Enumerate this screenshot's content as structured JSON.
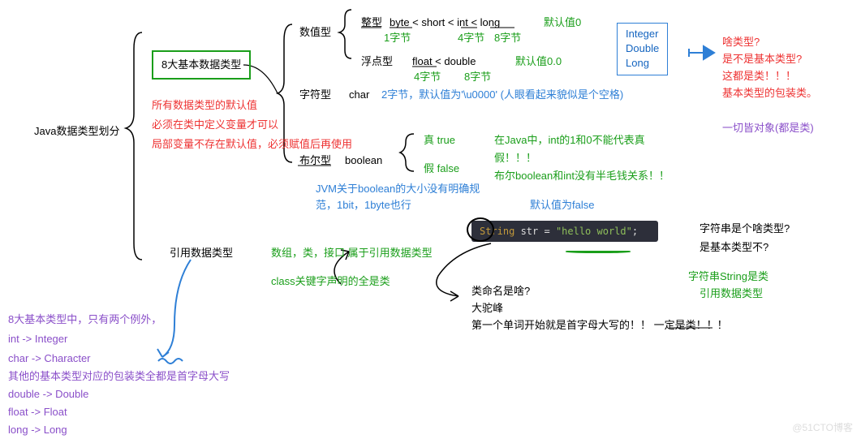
{
  "root": {
    "title": "Java数据类型划分"
  },
  "primitive": {
    "boxLabel": "8大基本数据类型",
    "defaultNote1": "所有数据类型的默认值",
    "defaultNote2": "必须在类中定义变量才可以",
    "defaultNote3": "局部变量不存在默认值，必须赋值后再使用",
    "numeric": {
      "label": "数值型",
      "integer": {
        "label": "整型",
        "order": "byte < short < int < long",
        "byteSize": "1字节",
        "intSize": "4字节",
        "longSize": "8字节",
        "default": "默认值0"
      },
      "float": {
        "label": "浮点型",
        "order": "float < double",
        "floatSize": "4字节",
        "doubleSize": "8字节",
        "default": "默认值0.0"
      }
    },
    "char": {
      "label": "字符型",
      "type": "char",
      "note": "2字节，默认值为'\\u0000' (人眼看起来貌似是个空格)"
    },
    "boolean": {
      "label": "布尔型",
      "type": "boolean",
      "trueLabel": "真 true",
      "falseLabel": "假 false",
      "jvmNote": "JVM关于boolean的大小没有明确规",
      "jvmNote2": "范，1bit，1byte也行",
      "intNote1": "在Java中，int的1和0不能代表真",
      "intNote2": "假！！！",
      "intNote3": "布尔boolean和int没有半毛钱关系！！",
      "defaultNote": "默认值为false"
    }
  },
  "wrapper": {
    "boxLine1": "Integer",
    "boxLine2": "Double",
    "boxLine3": "Long",
    "q1": "啥类型?",
    "q2": "是不是基本类型?",
    "q3": "这都是类！！！",
    "q4": "基本类型的包装类。",
    "allObj": "一切皆对象(都是类)"
  },
  "reference": {
    "label": "引用数据类型",
    "note1": "数组，类，接口 属于引用数据类型",
    "note2": "class关键字声明的全是类"
  },
  "code": {
    "kw": "String",
    "var": " str = ",
    "str": "\"hello world\"",
    "semi": ";"
  },
  "stringNotes": {
    "q1": "字符串是个啥类型?",
    "q2": "是基本类型不?",
    "a1": "字符串String是类",
    "a2": "引用数据类型"
  },
  "naming": {
    "q": "类命名是啥?",
    "a1": "大驼峰",
    "a2a": "第一个单词开始就是首字母大写的！！",
    "a2b": "一定是类",
    "a2c": "！！！"
  },
  "footer": {
    "l1": "8大基本类型中，只有两个例外，",
    "l2": "int -> Integer",
    "l3": "char -> Character",
    "l4": "其他的基本类型对应的包装类全都是首字母大写",
    "l5": "double -> Double",
    "l6": "float -> Float",
    "l7": "long -> Long"
  },
  "watermark": "@51CTO博客"
}
